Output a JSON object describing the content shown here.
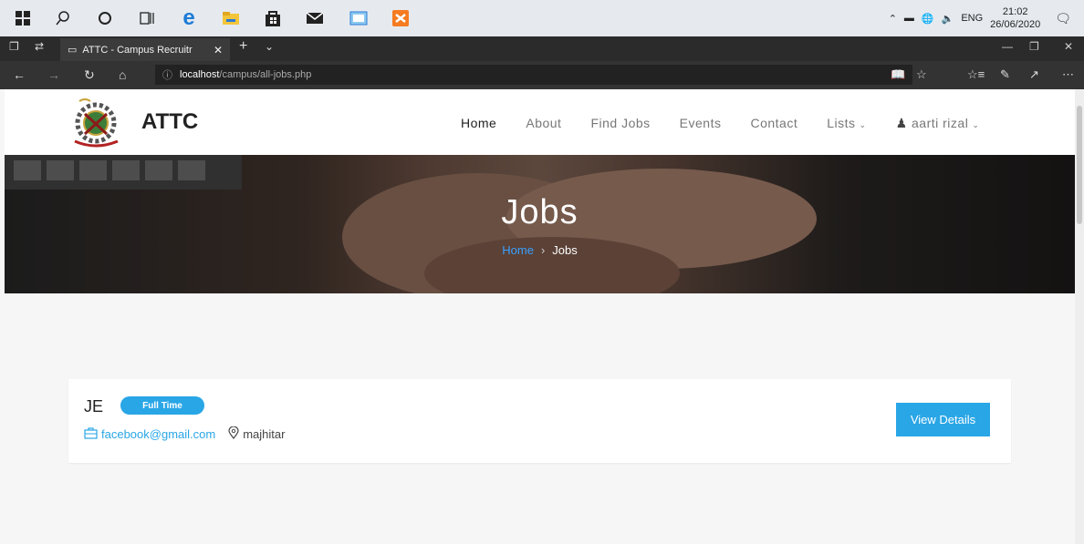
{
  "taskbar": {
    "icons": [
      "windows-start-icon",
      "search-icon",
      "cortana-icon",
      "task-view-icon",
      "edge-icon",
      "file-explorer-icon",
      "store-icon",
      "mail-icon",
      "calendar-icon",
      "xampp-icon"
    ],
    "tray": {
      "language": "ENG",
      "time": "21:02",
      "date": "26/06/2020"
    }
  },
  "browser": {
    "tab_title": "ATTC - Campus Recruitr",
    "url_host": "localhost",
    "url_path": "/campus/all-jobs.php"
  },
  "site": {
    "logo_text": "ATTC",
    "menu": [
      "Home",
      "About",
      "Find Jobs",
      "Events",
      "Contact",
      "Lists"
    ],
    "user_name": "aarti rizal"
  },
  "hero": {
    "title": "Jobs",
    "crumb_home": "Home",
    "crumb_current": "Jobs"
  },
  "job": {
    "title": "JE",
    "type": "Full Time",
    "email": "facebook@gmail.com",
    "location": "majhitar",
    "button": "View Details"
  },
  "colors": {
    "accent": "#29a6e6",
    "page_bg": "#f6f6f6"
  }
}
